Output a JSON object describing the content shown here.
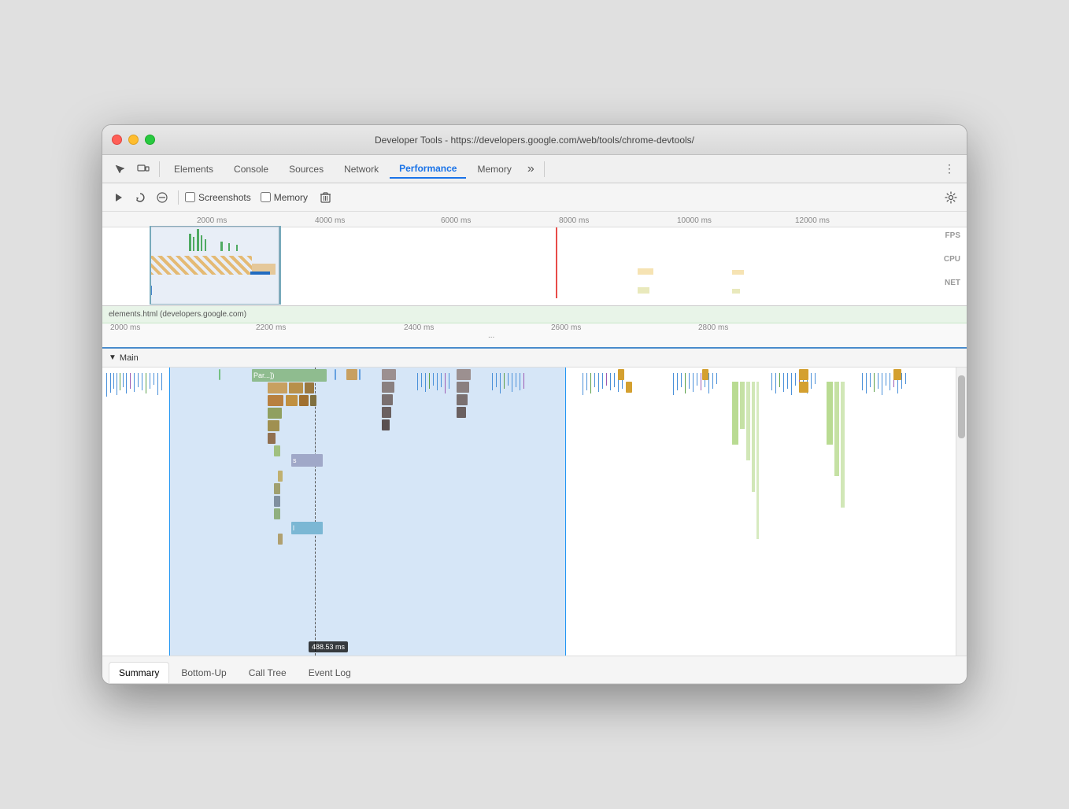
{
  "window": {
    "title": "Developer Tools - https://developers.google.com/web/tools/chrome-devtools/"
  },
  "nav": {
    "tabs": [
      {
        "label": "Elements",
        "active": false
      },
      {
        "label": "Console",
        "active": false
      },
      {
        "label": "Sources",
        "active": false
      },
      {
        "label": "Network",
        "active": false
      },
      {
        "label": "Performance",
        "active": true
      },
      {
        "label": "Memory",
        "active": false
      }
    ],
    "more": "»",
    "menu": "⋮"
  },
  "toolbar": {
    "record_label": "●",
    "reload_label": "↺",
    "clear_label": "⊘",
    "screenshots_label": "Screenshots",
    "memory_label": "Memory",
    "trash_label": "🗑",
    "gear_label": "⚙"
  },
  "timeline": {
    "overview_labels": [
      "2000 ms",
      "4000 ms",
      "6000 ms",
      "8000 ms",
      "10000 ms",
      "12000 ms"
    ],
    "fps_label": "FPS",
    "cpu_label": "CPU",
    "net_label": "NET"
  },
  "breadcrumb": {
    "text": "elements.html (developers.google.com)"
  },
  "zoom_timeline": {
    "labels": [
      "2000 ms",
      "2200 ms",
      "2400 ms",
      "2600 ms",
      "2800 ms"
    ],
    "dots": "..."
  },
  "flame": {
    "section": "Main",
    "bars": [
      {
        "label": "Par...])",
        "color": "#8fbc8f"
      },
      {
        "label": "s",
        "color": "#a0a0c8"
      },
      {
        "label": "l",
        "color": "#7bb7d4"
      }
    ],
    "time_label": "488.53 ms"
  },
  "bottom_tabs": [
    {
      "label": "Summary",
      "active": true
    },
    {
      "label": "Bottom-Up",
      "active": false
    },
    {
      "label": "Call Tree",
      "active": false
    },
    {
      "label": "Event Log",
      "active": false
    }
  ]
}
